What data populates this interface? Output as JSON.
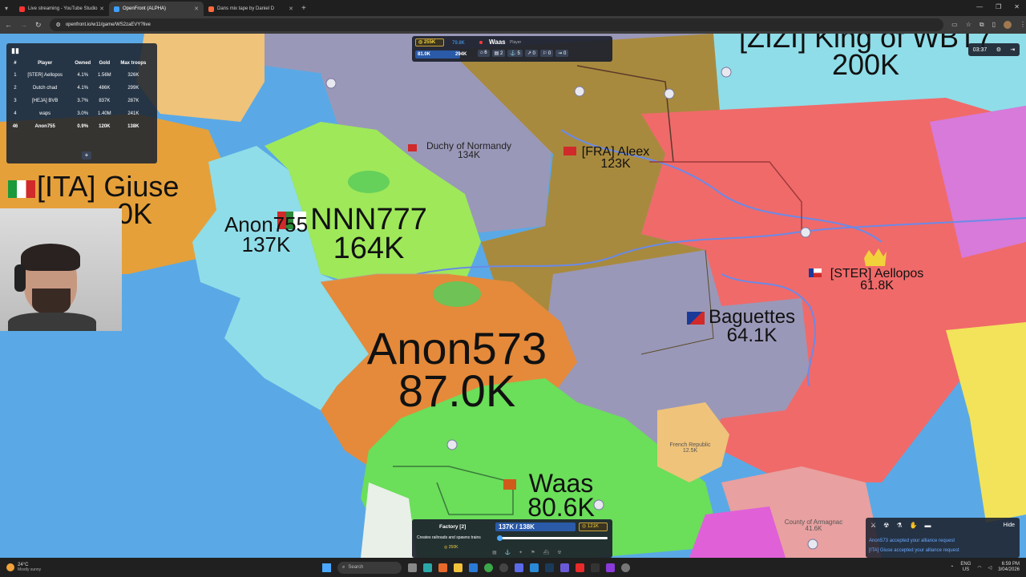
{
  "browser": {
    "tabs": [
      {
        "title": "Live streaming - YouTube Studio",
        "color": "#ff3333"
      },
      {
        "title": "OpenFront (ALPHA)",
        "color": "#3da0ff"
      },
      {
        "title": "Dans mix tape by Daniel D",
        "color": "#ff6a3d"
      }
    ],
    "url": "openfront.io/w11/game/WS2zaEVY?live"
  },
  "leaderboard": {
    "headers": [
      "#",
      "Player",
      "Owned",
      "Gold",
      "Max troops"
    ],
    "rows": [
      [
        "1",
        "[STER] Aellopos",
        "4.1%",
        "1.56M",
        "326K"
      ],
      [
        "2",
        "Dutch chad",
        "4.1%",
        "486K",
        "299K"
      ],
      [
        "3",
        "[HEJA] BVB",
        "3.7%",
        "837K",
        "287K"
      ],
      [
        "4",
        "waps",
        "3.0%",
        "1.40M",
        "241K"
      ],
      [
        "46",
        "Anon755",
        "0.9%",
        "120K",
        "138K"
      ]
    ],
    "expand": "+"
  },
  "player_bar": {
    "gold": "255K",
    "troops": "81.0K",
    "workers": "79.8K",
    "max": "294K",
    "name": "Waas",
    "role": "Player",
    "counts": [
      "6",
      "2",
      "5",
      "0",
      "0",
      "0"
    ]
  },
  "timer": "03:37",
  "map_labels": {
    "king": {
      "name": "[ZIZI] King of WBT7",
      "troops": "200K"
    },
    "ita": {
      "name": "[ITA] Giuse",
      "troops": "0K"
    },
    "normandy": {
      "name": "Duchy of Normandy",
      "troops": "134K"
    },
    "fra": {
      "name": "[FRA] Aleex",
      "troops": "123K"
    },
    "anon755": {
      "name": "Anon755",
      "troops": "137K"
    },
    "nnn": {
      "name": "NNN777",
      "troops": "164K"
    },
    "ster": {
      "name": "[STER] Aellopos",
      "troops": "61.8K"
    },
    "baguettes": {
      "name": "Baguettes",
      "troops": "64.1K"
    },
    "anon573": {
      "name": "Anon573",
      "troops": "87.0K"
    },
    "waas": {
      "name": "Waas",
      "troops": "80.6K"
    },
    "french_republic": {
      "name": "French Republic",
      "troops": "12.5K"
    },
    "armagnac": {
      "name": "County of Armagnac",
      "troops": "41.6K"
    }
  },
  "build_panel": {
    "title": "Factory [2]",
    "desc": "Creates railroads and spawns trains",
    "ratio": "137K / 138K",
    "cost": "121K",
    "gold": "250K"
  },
  "events": {
    "hide": "Hide",
    "messages": [
      "Anon573 accepted your alliance request",
      "[ITA] Giuse accepted your alliance request"
    ]
  },
  "taskbar": {
    "weather_temp": "24°C",
    "weather_desc": "Mostly sunny",
    "search": "Search",
    "lang1": "ENG",
    "lang2": "US",
    "time": "6:59 PM",
    "date": "3/04/2026"
  },
  "colors": {
    "ocean": "#5aa9e6",
    "orange": "#e58a3a",
    "lime": "#9ee85a",
    "green": "#6bde5a",
    "cyan": "#8fdde8",
    "olive": "#a88a3e",
    "grey": "#9a98b8",
    "red": "#f06a6a",
    "sand": "#efc37a",
    "yellow": "#f2e35a",
    "magenta": "#e060d8"
  }
}
